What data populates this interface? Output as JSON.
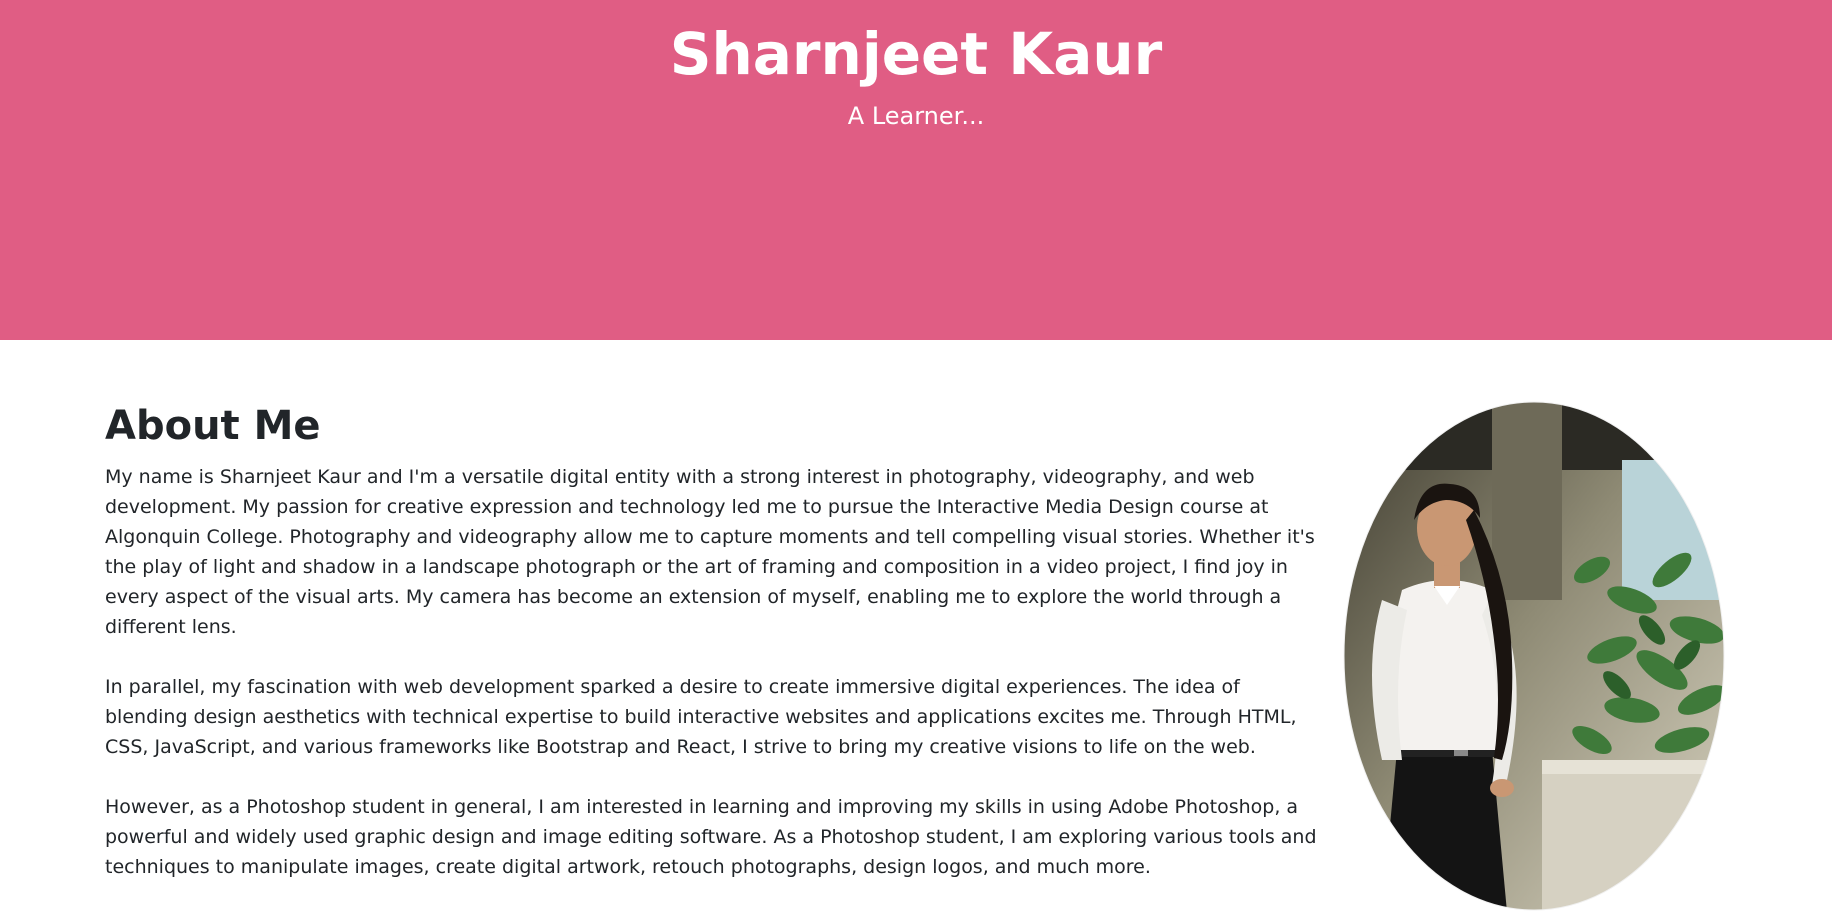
{
  "hero": {
    "title": "Sharnjeet Kaur",
    "subtitle": "A Learner...",
    "background_color": "#e05d84"
  },
  "about": {
    "heading": "About Me",
    "paragraphs": [
      "My name is Sharnjeet Kaur and I'm a versatile digital entity with a strong interest in photography, videography, and web development. My passion for creative expression and technology led me to pursue the Interactive Media Design course at Algonquin College. Photography and videography allow me to capture moments and tell compelling visual stories. Whether it's the play of light and shadow in a landscape photograph or the art of framing and composition in a video project, I find joy in every aspect of the visual arts. My camera has become an extension of myself, enabling me to explore the world through a different lens.",
      "In parallel, my fascination with web development sparked a desire to create immersive digital experiences. The idea of blending design aesthetics with technical expertise to build interactive websites and applications excites me. Through HTML, CSS, JavaScript, and various frameworks like Bootstrap and React, I strive to bring my creative visions to life on the web.",
      "However, as a Photoshop student in general, I am interested in learning and improving my skills in using Adobe Photoshop, a powerful and widely used graphic design and image editing software. As a Photoshop student, I am exploring various tools and techniques to manipulate images, create digital artwork, retouch photographs, design logos, and much more."
    ]
  },
  "portrait": {
    "icon": "profile-photo"
  }
}
